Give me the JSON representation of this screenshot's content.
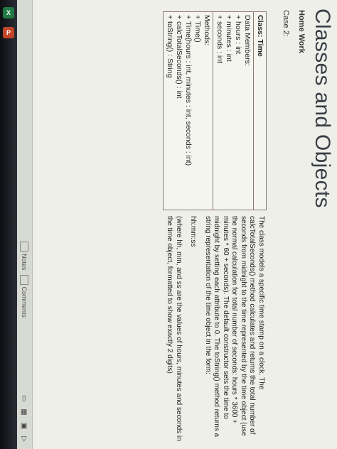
{
  "taskbar": {
    "excel_label": "X",
    "ppt_label": "P"
  },
  "slide": {
    "title": "Classes and Objects",
    "subtitle": "Home Work",
    "case": "Case 2:"
  },
  "uml": {
    "class_name": "Class: Time",
    "data_header": "Data Members:",
    "data_members": [
      "+ hours : int",
      "+ minutes : int",
      "+ seconds : int"
    ],
    "methods_header": "Methods:",
    "methods": [
      "+ Time()",
      "+ Time(hours : int, minutes : int, seconds : int)",
      "+ calcTotalSeconds() : int",
      "+ toString() : String"
    ]
  },
  "description": {
    "paragraph1": "The class models a specific time stamp on a clock. The calcTotalSeconds() method calculates and returns the total number of seconds from midnight to the time represented by the time object (use the normal calculation for total number of seconds: hours * 3600 + minutes * 60 + seconds). The default constructor sets the time to midnight by setting each attribute to 0. The toString() method returns a string representation of the time object in the form:",
    "format": "hh:mm:ss",
    "paragraph2": "(where hh, mm, and ss are the values of hours, minutes and seconds in the time object, formatted to show exactly 2 digits)"
  },
  "status_bar": {
    "notes_label": "Notes",
    "comments_label": "Comments"
  }
}
